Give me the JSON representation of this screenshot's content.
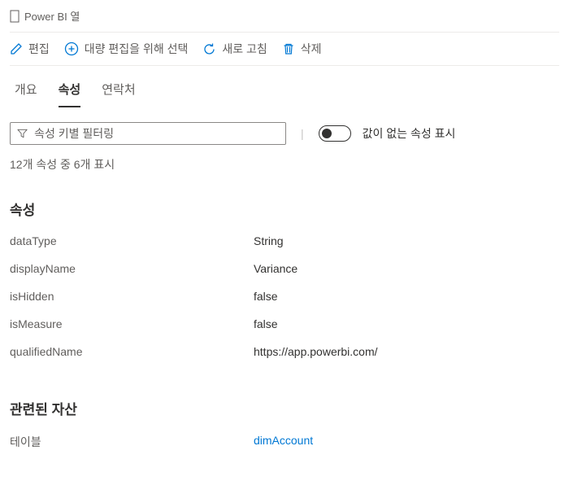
{
  "header": {
    "type_label": "Power BI 열"
  },
  "toolbar": {
    "edit": "편집",
    "bulk_select": "대량 편집을 위해 선택",
    "refresh": "새로 고침",
    "delete": "삭제"
  },
  "tabs": {
    "overview": "개요",
    "properties": "속성",
    "contacts": "연락처"
  },
  "filter": {
    "placeholder": "속성 키별 필터링",
    "toggle_label": "값이 없는 속성 표시",
    "count_text": "12개 속성 중 6개 표시"
  },
  "properties_section": {
    "title": "속성",
    "rows": [
      {
        "key": "dataType",
        "value": "String"
      },
      {
        "key": "displayName",
        "value": "Variance"
      },
      {
        "key": "isHidden",
        "value": "false"
      },
      {
        "key": "isMeasure",
        "value": "false"
      },
      {
        "key": "qualifiedName",
        "value": "https://app.powerbi.com/"
      }
    ]
  },
  "related_section": {
    "title": "관련된 자산",
    "rows": [
      {
        "key": "테이블",
        "value": "dimAccount",
        "is_link": true
      }
    ]
  }
}
